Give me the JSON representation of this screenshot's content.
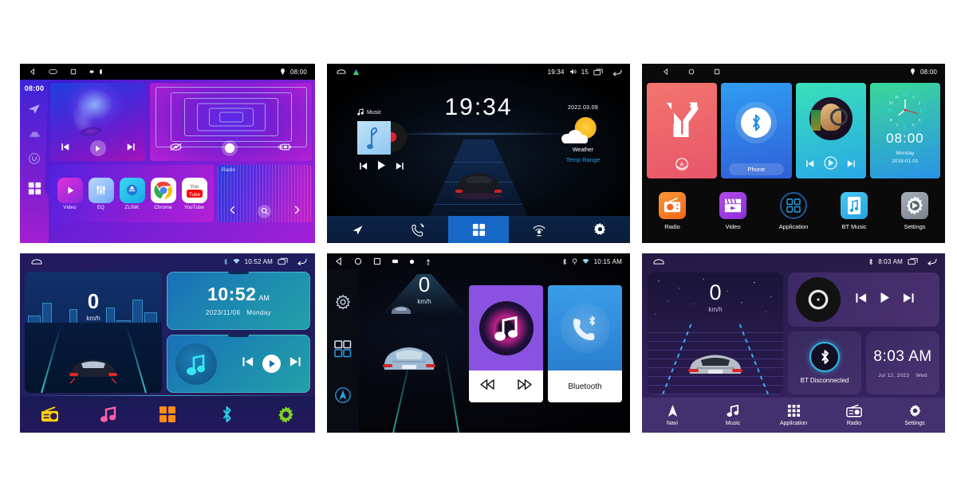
{
  "page": {
    "title": "Car Head Unit Home Screen UI Variants",
    "background": "#ffffff"
  },
  "panels": [
    {
      "id": "panel-1-purple-neon",
      "statusbar": {
        "icons": [
          "back-icon",
          "home-icon",
          "recents-icon",
          "sd-icon",
          "usb-icon"
        ],
        "location_icon": "location-pin-icon",
        "time": "08:00"
      },
      "sidebar": {
        "time": "08:00",
        "items": [
          "navigation-icon",
          "car-icon",
          "circle-icon",
          "apps-grid-icon"
        ]
      },
      "media": {
        "prev": "prev-track-icon",
        "play": "play-icon",
        "next": "next-track-icon"
      },
      "video_controls": {
        "left": "rear-camera-icon",
        "record": "record-icon",
        "right": "camera-icon"
      },
      "apps": [
        {
          "label": "Video",
          "icon": "video-icon",
          "color": "#e030d8"
        },
        {
          "label": "EQ",
          "icon": "equalizer-icon",
          "color": "#6fa8f5"
        },
        {
          "label": "ZLINK",
          "icon": "zlink-icon",
          "color": "#18a8e8"
        },
        {
          "label": "Chrome",
          "icon": "chrome-icon",
          "color": "#ffffff"
        },
        {
          "label": "YouTube",
          "icon": "youtube-icon",
          "color": "#ff0000"
        }
      ],
      "radio": {
        "label": "Radio",
        "prev": "chevron-left-icon",
        "search": "search-icon",
        "next": "chevron-right-icon"
      }
    },
    {
      "id": "panel-2-black-blue",
      "statusbar": {
        "left_icons": [
          "home-icon",
          "app-icon"
        ],
        "time": "19:34",
        "volume_icon": "volume-icon",
        "volume_level": "15",
        "recents_icon": "recents-icon",
        "back_icon": "back-arrow-icon"
      },
      "clock": "19:34",
      "music": {
        "label": "Music",
        "note_icon": "music-note-icon",
        "prev": "prev-track-icon",
        "play": "play-icon",
        "next": "next-track-icon"
      },
      "weather": {
        "date": "2022.03.09",
        "icon": "sun-cloud-icon",
        "label": "Weather",
        "temp_range": "Temp Range"
      },
      "navbar": [
        {
          "name": "navigation-icon",
          "active": false
        },
        {
          "name": "phone-icon",
          "active": false
        },
        {
          "name": "apps-grid-icon",
          "active": true
        },
        {
          "name": "radio-tower-icon",
          "active": false
        },
        {
          "name": "settings-gear-icon",
          "active": false
        }
      ]
    },
    {
      "id": "panel-3-colorful-tiles",
      "statusbar": {
        "icons": [
          "back-icon",
          "home-icon",
          "recents-icon"
        ],
        "location_icon": "location-pin-icon",
        "time": "08:00"
      },
      "tiles": [
        {
          "name": "navigation-tile",
          "caption": "",
          "icon": "road-fork-icon"
        },
        {
          "name": "phone-tile",
          "caption": "Phone",
          "icon": "bluetooth-icon"
        },
        {
          "name": "music-tile",
          "caption": "",
          "icon": "headphones-photo"
        },
        {
          "name": "clock-tile",
          "caption": "",
          "time": "08:00",
          "day": "Monday",
          "date": "2018-01-01"
        }
      ],
      "clock_numerals": [
        "12",
        "1",
        "2",
        "3",
        "4",
        "5",
        "6",
        "7",
        "8",
        "9",
        "10",
        "11"
      ],
      "bottom": [
        {
          "label": "Radio",
          "icon": "radio-icon"
        },
        {
          "label": "Video",
          "icon": "video-icon"
        },
        {
          "label": "Application",
          "icon": "apps-grid-icon"
        },
        {
          "label": "BT Music",
          "icon": "bt-music-icon"
        },
        {
          "label": "Settings",
          "icon": "settings-gear-icon"
        }
      ]
    },
    {
      "id": "panel-4-blue-city",
      "statusbar": {
        "home_icon": "home-icon",
        "bluetooth_icon": "bluetooth-icon",
        "wifi_icon": "wifi-icon",
        "time": "10:52 AM",
        "recents_icon": "recents-icon",
        "back_icon": "back-arrow-icon"
      },
      "speed": {
        "value": "0",
        "unit": "km/h"
      },
      "clock": {
        "time": "10:52",
        "ampm": "AM",
        "date": "2023/11/06",
        "day": "Monday"
      },
      "music": {
        "icon": "music-note-icon",
        "prev": "prev-track-icon",
        "play": "play-icon",
        "next": "next-track-icon"
      },
      "navbar": [
        {
          "name": "radio-icon",
          "color": "#ffd200"
        },
        {
          "name": "music-note-icon",
          "color": "#ff5fa8"
        },
        {
          "name": "apps-grid-icon",
          "color": "#ff8c1a"
        },
        {
          "name": "bluetooth-icon",
          "color": "#2ad0e8"
        },
        {
          "name": "settings-gear-icon",
          "color": "#7ed321"
        }
      ]
    },
    {
      "id": "panel-5-dark-space",
      "statusbar": {
        "icons": [
          "back-icon",
          "home-icon",
          "recents-icon",
          "sd-icon",
          "gps-icon",
          "usb-icon"
        ],
        "right_icons": [
          "bluetooth-icon",
          "location-pin-icon",
          "wifi-icon"
        ],
        "time": "10:15 AM"
      },
      "sidebar": [
        "settings-gear-icon",
        "apps-grid-icon",
        "navigation-icon"
      ],
      "speed": {
        "value": "0",
        "unit": "km/h"
      },
      "cards": [
        {
          "name": "music-card",
          "icon": "music-note-icon",
          "prev": "prev-track-icon",
          "next": "next-track-icon",
          "label": ""
        },
        {
          "name": "bluetooth-card",
          "icon": "bt-phone-icon",
          "label": "Bluetooth"
        }
      ]
    },
    {
      "id": "panel-6-purple-gradient",
      "statusbar": {
        "home_icon": "home-icon",
        "bluetooth_icon": "bluetooth-icon",
        "time": "8:03 AM",
        "recents_icon": "recents-icon",
        "back_icon": "back-arrow-icon"
      },
      "speed": {
        "value": "0",
        "unit": "km/h"
      },
      "music": {
        "vinyl_icon": "vinyl-record-icon",
        "prev": "prev-track-icon",
        "play": "play-icon",
        "next": "next-track-icon"
      },
      "bluetooth": {
        "icon": "bluetooth-icon",
        "status": "BT Disconnected"
      },
      "clock": {
        "time": "8:03 AM",
        "date": "Jul 12, 2023",
        "day": "Wed"
      },
      "navbar": [
        {
          "label": "Navi",
          "icon": "navigation-icon"
        },
        {
          "label": "Music",
          "icon": "music-note-icon"
        },
        {
          "label": "Application",
          "icon": "apps-grid-icon"
        },
        {
          "label": "Radio",
          "icon": "radio-icon"
        },
        {
          "label": "Settings",
          "icon": "settings-gear-icon"
        }
      ]
    }
  ]
}
